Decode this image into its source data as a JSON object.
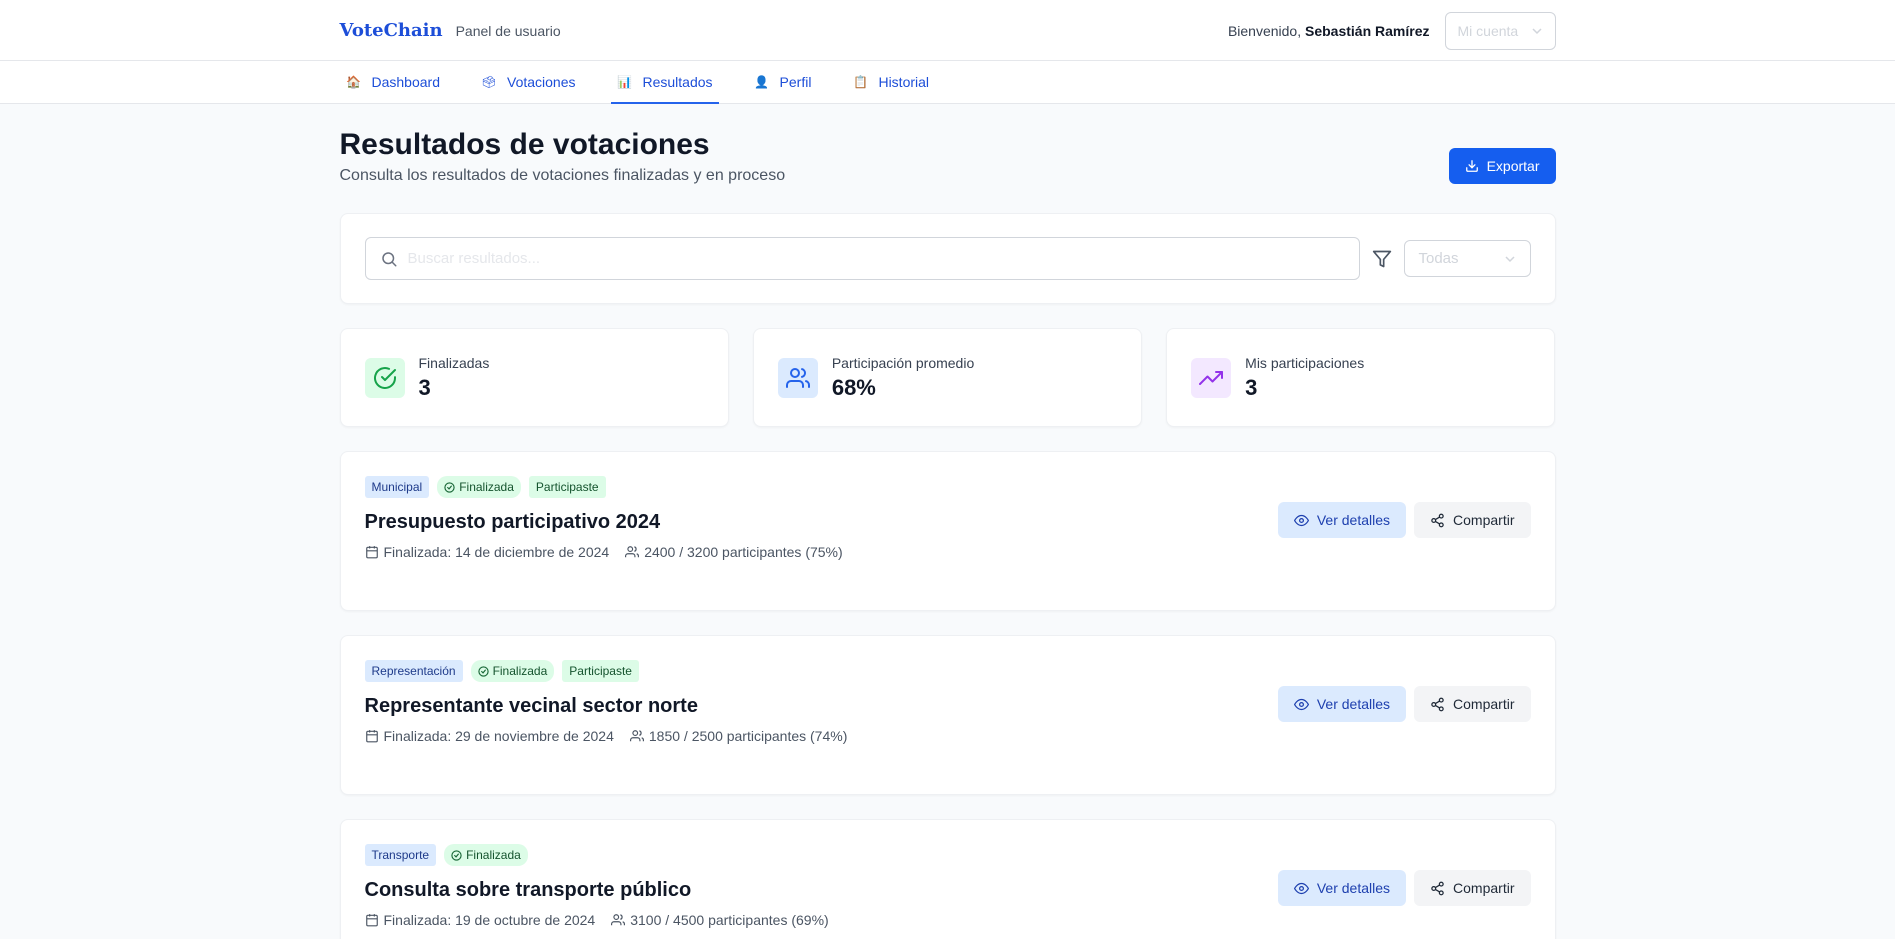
{
  "header": {
    "logo": "VoteChain",
    "panel_label": "Panel de usuario",
    "welcome": "Bienvenido,",
    "user_name": "Sebastián Ramírez",
    "account_menu": "Mi cuenta"
  },
  "nav": [
    {
      "label": "Dashboard",
      "icon": "house-icon",
      "glyph": "🏠"
    },
    {
      "label": "Votaciones",
      "icon": "ballot-box-icon",
      "glyph": "🗳"
    },
    {
      "label": "Resultados",
      "icon": "bar-chart-icon",
      "glyph": "📊",
      "active": true
    },
    {
      "label": "Perfil",
      "icon": "user-icon",
      "glyph": "👤"
    },
    {
      "label": "Historial",
      "icon": "clipboard-icon",
      "glyph": "📋"
    }
  ],
  "page": {
    "title": "Resultados de votaciones",
    "subtitle": "Consulta los resultados de votaciones finalizadas y en proceso",
    "export_label": "Exportar"
  },
  "search": {
    "placeholder": "Buscar resultados...",
    "filter_value": "Todas"
  },
  "stats": [
    {
      "label": "Finalizadas",
      "value": "3",
      "icon": "check-circle-icon",
      "bg": "#dcfce7",
      "color": "#16a34a"
    },
    {
      "label": "Participación promedio",
      "value": "68%",
      "icon": "users-icon",
      "bg": "#dbeafe",
      "color": "#2563eb"
    },
    {
      "label": "Mis participaciones",
      "value": "3",
      "icon": "trending-up-icon",
      "bg": "#f3e8ff",
      "color": "#9333ea"
    }
  ],
  "results": [
    {
      "category": "Municipal",
      "status": "Finalizada",
      "participated": "Participaste",
      "title": "Presupuesto participativo 2024",
      "date": "Finalizada: 14 de diciembre de 2024",
      "participants": "2400 / 3200 participantes (75%)"
    },
    {
      "category": "Representación",
      "status": "Finalizada",
      "participated": "Participaste",
      "title": "Representante vecinal sector norte",
      "date": "Finalizada: 29 de noviembre de 2024",
      "participants": "1850 / 2500 participantes (74%)"
    },
    {
      "category": "Transporte",
      "status": "Finalizada",
      "participated": "",
      "title": "Consulta sobre transporte público",
      "date": "Finalizada: 19 de octubre de 2024",
      "participants": "3100 / 4500 participantes (69%)"
    }
  ],
  "actions": {
    "details_label": "Ver detalles",
    "share_label": "Compartir"
  }
}
